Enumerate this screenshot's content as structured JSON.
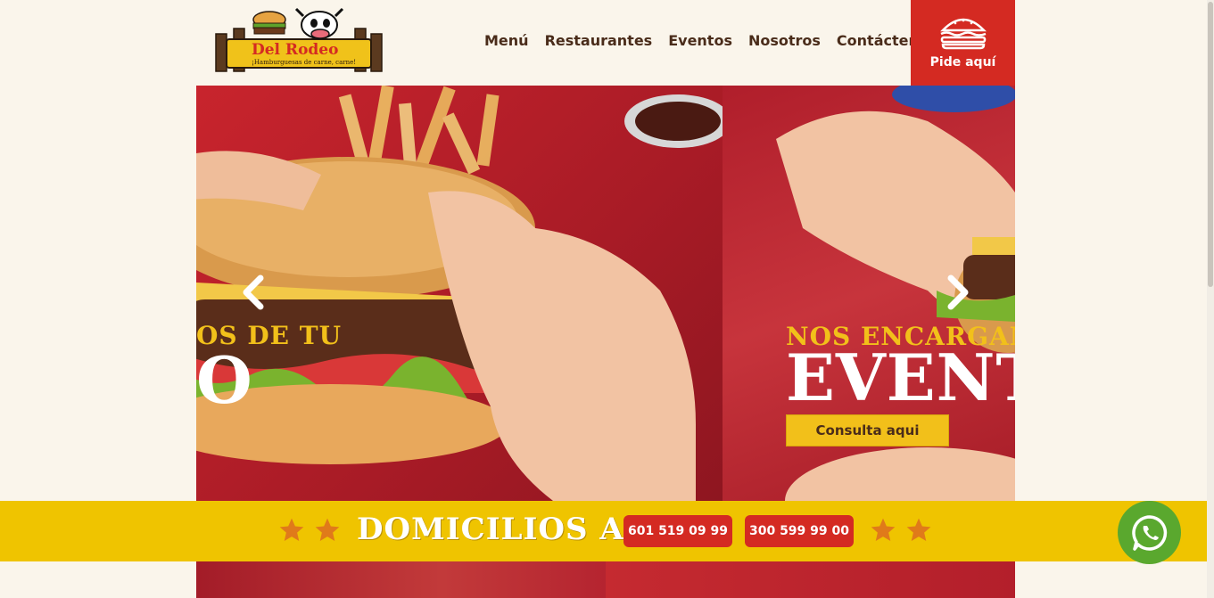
{
  "header": {
    "logo": {
      "brand": "Del Rodeo",
      "tagline": "¡Hamburguesas de carne, carne!"
    },
    "nav": [
      {
        "label": "Menú"
      },
      {
        "label": "Restaurantes"
      },
      {
        "label": "Eventos"
      },
      {
        "label": "Nosotros"
      },
      {
        "label": "Contáctenos"
      }
    ],
    "order_button": {
      "label": "Pide aquí",
      "icon": "burger-icon"
    }
  },
  "slider": {
    "slides": [
      {
        "small": "OS DE TU",
        "big": "O"
      },
      {
        "small": "NOS ENCARGAMO",
        "big": "EVENT",
        "button": "Consulta aqui"
      }
    ],
    "prev_icon": "chevron-left-icon",
    "next_icon": "chevron-right-icon"
  },
  "delivery": {
    "title": "DOMICILIOS AL",
    "phones": [
      "601 519 09 99",
      "300 599 99 00"
    ]
  },
  "whatsapp": {
    "icon": "whatsapp-icon"
  },
  "colors": {
    "brand_red": "#d42a22",
    "brand_yellow": "#efc400",
    "text_brown": "#4a2c1a",
    "background": "#faf5eb",
    "whatsapp_green": "#5aa82e"
  }
}
